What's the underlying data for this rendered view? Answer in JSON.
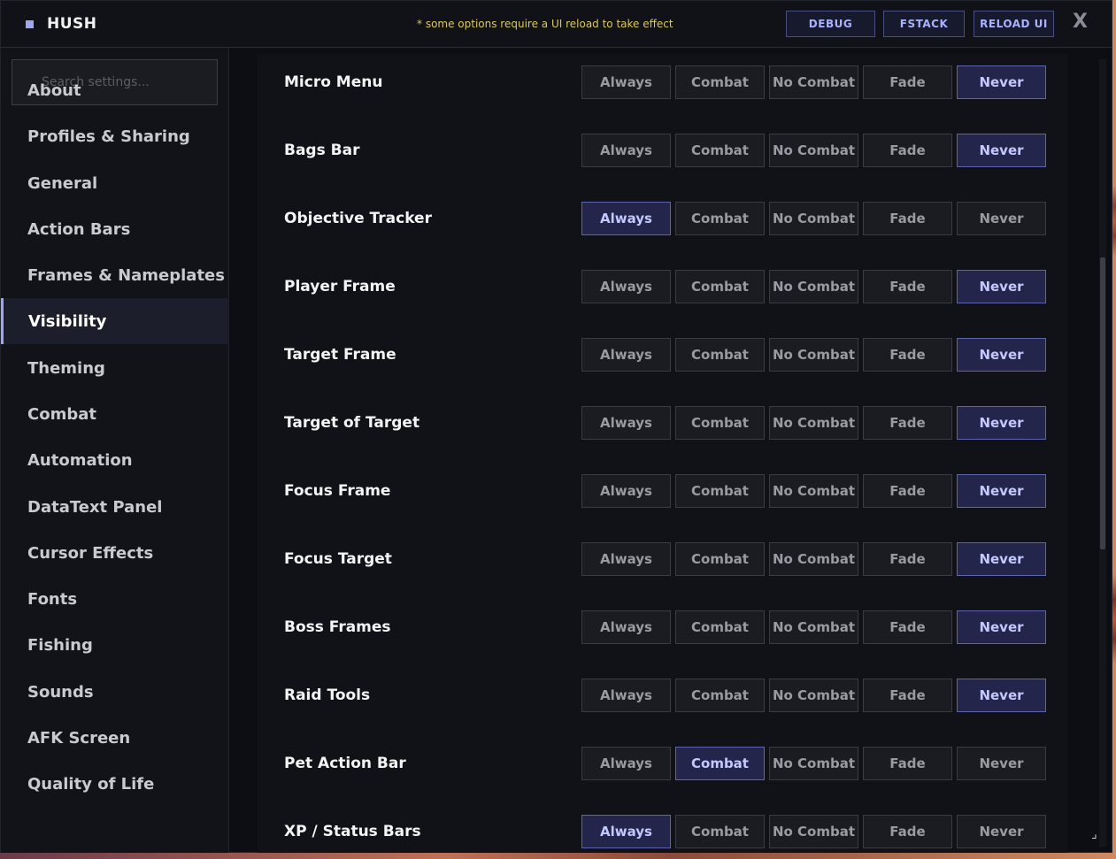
{
  "header": {
    "title": "HUSH",
    "notice": "* some options require a UI reload to take effect",
    "buttons": [
      "DEBUG",
      "FSTACK",
      "RELOAD UI"
    ],
    "close_label": "X"
  },
  "sidebar": {
    "search_placeholder": "Search settings...",
    "items": [
      {
        "label": "About"
      },
      {
        "label": "Profiles & Sharing"
      },
      {
        "label": "General"
      },
      {
        "label": "Action Bars"
      },
      {
        "label": "Frames & Nameplates"
      },
      {
        "label": "Visibility",
        "active": true
      },
      {
        "label": "Theming"
      },
      {
        "label": "Combat"
      },
      {
        "label": "Automation"
      },
      {
        "label": "DataText Panel"
      },
      {
        "label": "Cursor Effects"
      },
      {
        "label": "Fonts"
      },
      {
        "label": "Fishing"
      },
      {
        "label": "Sounds"
      },
      {
        "label": "AFK Screen"
      },
      {
        "label": "Quality of Life"
      }
    ]
  },
  "options": [
    "Always",
    "Combat",
    "No Combat",
    "Fade",
    "Never"
  ],
  "rows": [
    {
      "label": "Micro Menu",
      "selected": "Never"
    },
    {
      "label": "Bags Bar",
      "selected": "Never"
    },
    {
      "label": "Objective Tracker",
      "selected": "Always"
    },
    {
      "label": "Player Frame",
      "selected": "Never"
    },
    {
      "label": "Target Frame",
      "selected": "Never"
    },
    {
      "label": "Target of Target",
      "selected": "Never"
    },
    {
      "label": "Focus Frame",
      "selected": "Never"
    },
    {
      "label": "Focus Target",
      "selected": "Never"
    },
    {
      "label": "Boss Frames",
      "selected": "Never"
    },
    {
      "label": "Raid Tools",
      "selected": "Never"
    },
    {
      "label": "Pet Action Bar",
      "selected": "Combat"
    },
    {
      "label": "XP / Status Bars",
      "selected": "Always"
    }
  ],
  "colors": {
    "accent": "#9ea6f0",
    "notice": "#d8c85a",
    "selected_bg": "#23264a",
    "window_bg": "#0d0e13"
  }
}
